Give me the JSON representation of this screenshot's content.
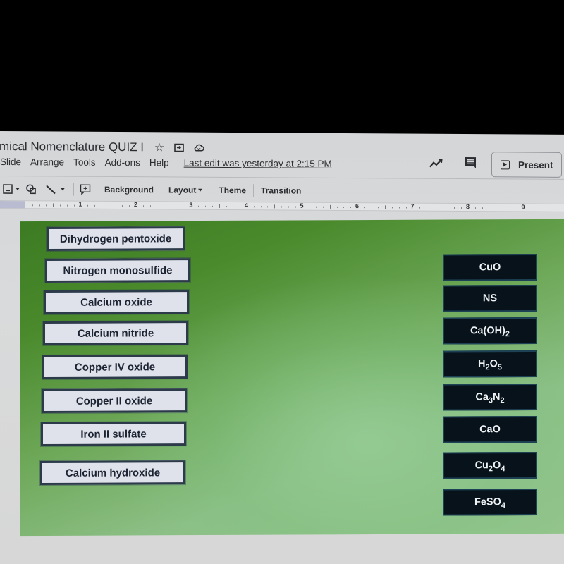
{
  "app": {
    "doc_title": "mical Nomenclature QUIZ I",
    "title_icons": [
      "star-icon",
      "move-to-folder-icon",
      "cloud-saved-icon"
    ],
    "menu": [
      "Slide",
      "Arrange",
      "Tools",
      "Add-ons",
      "Help"
    ],
    "last_edit": "Last edit was yesterday at 2:15 PM",
    "present_label": "Present",
    "right_icons": [
      "activity-trend-icon",
      "comments-icon"
    ]
  },
  "toolbar": {
    "items": [
      {
        "icon": "image-icon"
      },
      {
        "icon": "shape-icon"
      },
      {
        "icon": "line-icon"
      },
      {
        "icon": "add-comment-icon"
      }
    ],
    "background_label": "Background",
    "layout_label": "Layout",
    "theme_label": "Theme",
    "transition_label": "Transition"
  },
  "ruler": {
    "numbers": [
      "1",
      "2",
      "3",
      "4",
      "5",
      "6",
      "7",
      "8",
      "9"
    ]
  },
  "slide": {
    "names": [
      "Dihydrogen pentoxide",
      "Nitrogen monosulfide",
      "Calcium oxide",
      "Calcium nitride",
      "Copper IV oxide",
      "Copper II oxide",
      "Iron II sulfate",
      "Calcium hydroxide"
    ],
    "formulas": [
      {
        "parts": [
          [
            "CuO",
            ""
          ]
        ]
      },
      {
        "parts": [
          [
            "NS",
            ""
          ]
        ]
      },
      {
        "parts": [
          [
            "Ca(OH)",
            "2"
          ]
        ]
      },
      {
        "parts": [
          [
            "H",
            "2"
          ],
          [
            "O",
            "5"
          ]
        ]
      },
      {
        "parts": [
          [
            "Ca",
            "3"
          ],
          [
            "N",
            "2"
          ]
        ]
      },
      {
        "parts": [
          [
            "CaO",
            ""
          ]
        ]
      },
      {
        "parts": [
          [
            "Cu",
            "2"
          ],
          [
            "O",
            "4"
          ]
        ]
      },
      {
        "parts": [
          [
            "FeSO",
            "4"
          ]
        ]
      }
    ],
    "formula_labels": [
      "CuO",
      "NS",
      "Ca(OH)2",
      "H2O5",
      "Ca3N2",
      "CaO",
      "Cu2O4",
      "FeSO4"
    ],
    "colors": {
      "name_card_bg": "#dfe2ea",
      "formula_card_bg": "#07121a",
      "slide_green": "#4a8a2c"
    }
  }
}
